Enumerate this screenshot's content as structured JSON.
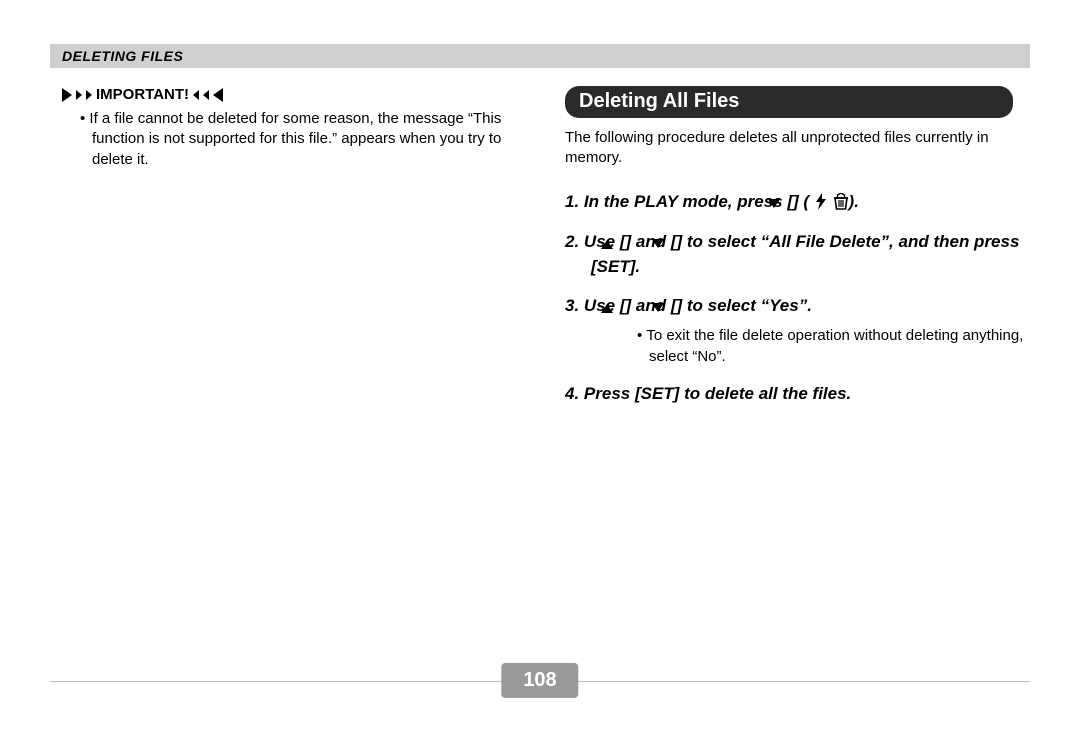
{
  "header": {
    "title": "DELETING FILES"
  },
  "left": {
    "important_label": "IMPORTANT!",
    "important_note": "If a file cannot be deleted for some reason, the message “This function is not supported for this file.” appears when you try to delete it."
  },
  "right": {
    "section_title": "Deleting All Files",
    "intro": "The following procedure deletes all unprotected files currently in memory.",
    "steps": {
      "s1_a": "In the PLAY mode, press [",
      "s1_b": "] (",
      "s1_c": ").",
      "s2_a": "Use [",
      "s2_b": "] and [",
      "s2_c": "] to select “All File Delete”, and then press [SET].",
      "s3_a": "Use [",
      "s3_b": "] and [",
      "s3_c": "] to select “Yes”.",
      "s3_sub": "To exit the file delete operation without deleting anything, select “No”.",
      "s4": "Press [SET] to delete all the files."
    }
  },
  "page_number": "108"
}
